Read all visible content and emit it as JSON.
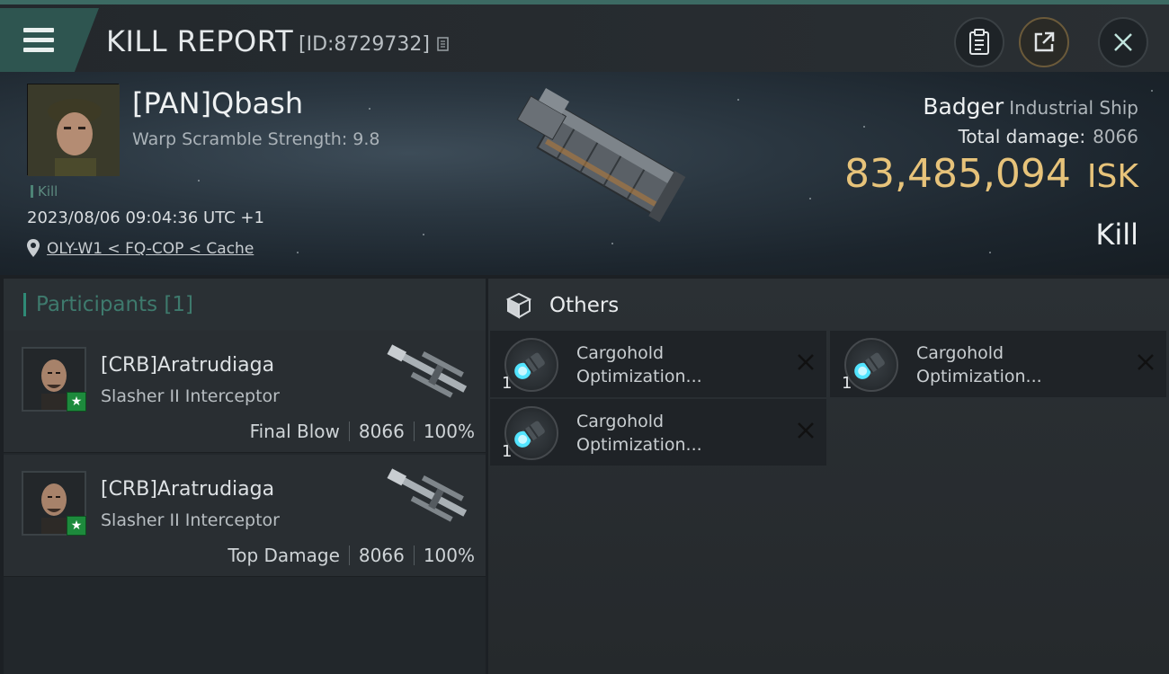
{
  "header": {
    "title": "KILL REPORT",
    "report_id": "[ID:8729732]"
  },
  "victim": {
    "name": "[PAN]Qbash",
    "scramble": "Warp Scramble Strength: 9.8",
    "tag": "Kill",
    "time": "2023/08/06 09:04:36 UTC +1",
    "location": "OLY-W1 < FQ-COP < Cache"
  },
  "ship": {
    "name": "Badger",
    "class": "Industrial Ship",
    "damage_label": "Total damage:",
    "damage_value": "8066",
    "isk_value": "83,485,094",
    "isk_unit": "ISK",
    "result": "Kill"
  },
  "participants": {
    "header": "Participants [1]",
    "items": [
      {
        "name": "[CRB]Aratrudiaga",
        "ship": "Slasher II Interceptor",
        "role": "Final Blow",
        "damage": "8066",
        "percent": "100%"
      },
      {
        "name": "[CRB]Aratrudiaga",
        "ship": "Slasher II Interceptor",
        "role": "Top Damage",
        "damage": "8066",
        "percent": "100%"
      }
    ]
  },
  "others": {
    "header": "Others",
    "items": [
      {
        "qty": "1",
        "name_line1": "Cargohold",
        "name_line2": "Optimization..."
      },
      {
        "qty": "1",
        "name_line1": "Cargohold",
        "name_line2": "Optimization..."
      },
      {
        "qty": "1",
        "name_line1": "Cargohold",
        "name_line2": "Optimization..."
      }
    ]
  },
  "colors": {
    "accent_teal": "#2f8a76",
    "isk_gold": "#e7c37a",
    "badge_green": "#1d8a3c"
  }
}
